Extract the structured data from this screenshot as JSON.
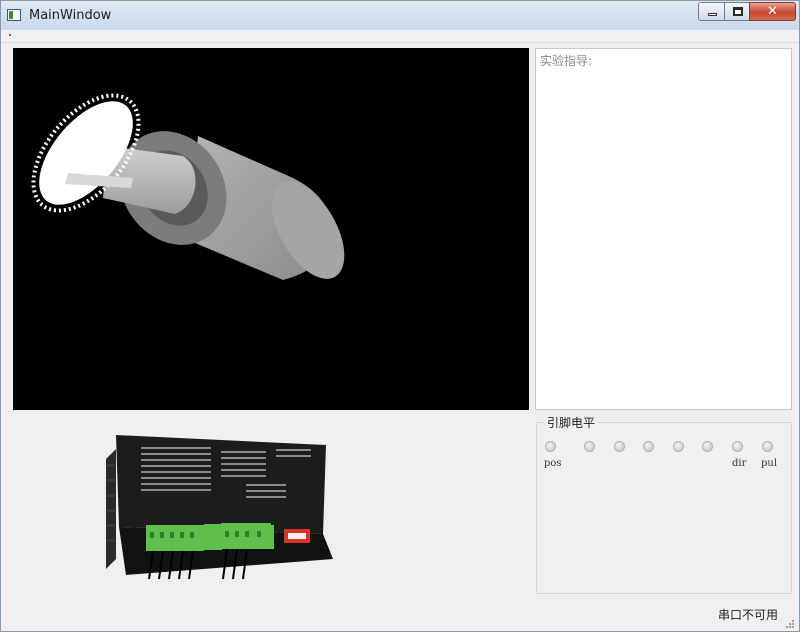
{
  "window": {
    "title": "MainWindow",
    "icon": "window-app-icon"
  },
  "caption_buttons": {
    "minimize": "minimize-icon",
    "maximize": "maximize-icon",
    "close": "close-icon",
    "close_glyph": "✕"
  },
  "viewport": {
    "content": "3D render of gear shaft and cylinder",
    "background": "#000000"
  },
  "guide": {
    "label": "实验指导:"
  },
  "pin_levels": {
    "title": "引脚电平",
    "leds": [
      {
        "name": "pos",
        "label": "pos"
      },
      {
        "name": "led-2",
        "label": ""
      },
      {
        "name": "led-3",
        "label": ""
      },
      {
        "name": "led-4",
        "label": ""
      },
      {
        "name": "led-5",
        "label": ""
      },
      {
        "name": "led-6",
        "label": ""
      },
      {
        "name": "dir",
        "label": "dir"
      },
      {
        "name": "pul",
        "label": "pul"
      }
    ]
  },
  "status": {
    "text": "串口不可用"
  },
  "colors": {
    "terminal_green": "#5fbf4a",
    "dip_switch": "#d9342b",
    "driver_body": "#1c1c1c"
  }
}
